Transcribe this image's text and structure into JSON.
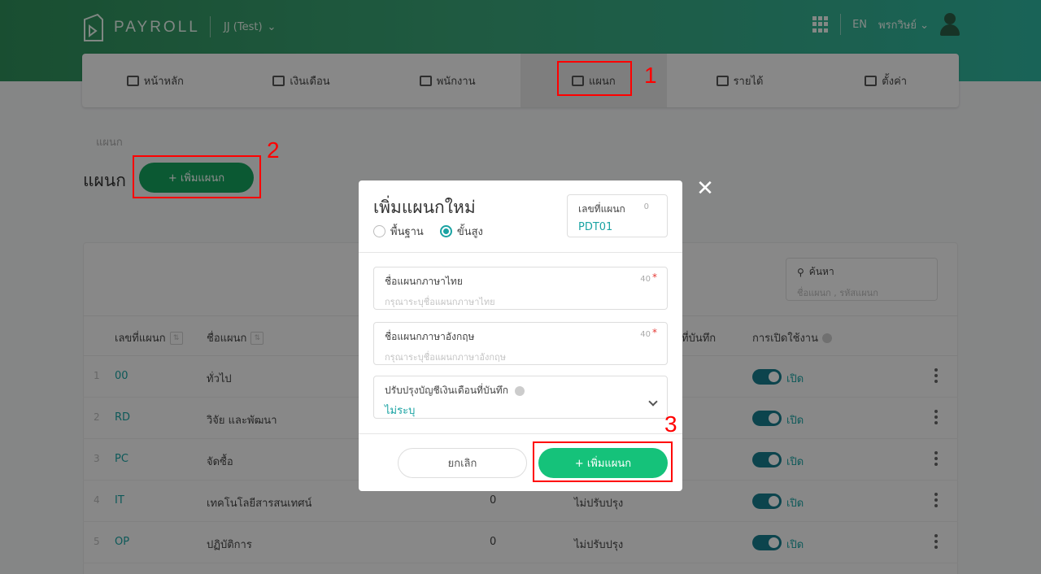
{
  "header": {
    "logo_text": "PAYROLL",
    "company": "JJ (Test)",
    "language": "EN",
    "user_name": "พรกวิษย์"
  },
  "nav": [
    {
      "label": "หน้าหลัก",
      "icon": "chart-icon"
    },
    {
      "label": "เงินเดือน",
      "icon": "calendar-money-icon"
    },
    {
      "label": "พนักงาน",
      "icon": "people-icon"
    },
    {
      "label": "แผนก",
      "icon": "id-card-icon",
      "active": true
    },
    {
      "label": "รายได้",
      "icon": "money-icon"
    },
    {
      "label": "ตั้งค่า",
      "icon": "gears-icon"
    }
  ],
  "page": {
    "breadcrumb": "แผนก",
    "title": "แผนก",
    "add_button": "+ เพิ่มแผนก"
  },
  "search": {
    "label": "ค้นหา",
    "placeholder": "ชื่อแผนก , รหัสแผนก"
  },
  "table": {
    "columns": [
      "เลขที่แผนก",
      "ชื่อแผนก",
      "ที่บันทึก",
      "การเปิดใช้งาน"
    ],
    "rows": [
      {
        "index": "1",
        "code": "00",
        "name": "ทั่วไป",
        "count": "",
        "adjust": "",
        "status": "เปิด"
      },
      {
        "index": "2",
        "code": "RD",
        "name": "วิจัย และพัฒนา",
        "count": "",
        "adjust": "",
        "status": "เปิด"
      },
      {
        "index": "3",
        "code": "PC",
        "name": "จัดซื้อ",
        "count": "",
        "adjust": "",
        "status": "เปิด"
      },
      {
        "index": "4",
        "code": "IT",
        "name": "เทคโนโลยีสารสนเทศน์",
        "count": "0",
        "adjust": "ไม่ปรับปรุง",
        "status": "เปิด"
      },
      {
        "index": "5",
        "code": "OP",
        "name": "ปฏิบัติการ",
        "count": "0",
        "adjust": "ไม่ปรับปรุง",
        "status": "เปิด"
      }
    ]
  },
  "modal": {
    "title": "เพิ่มแผนกใหม่",
    "radio_basic": "พื้นฐาน",
    "radio_advanced": "ขั้นสูง",
    "selected_mode": "advanced",
    "code_label": "เลขที่แผนก",
    "code_count": "0",
    "code_value": "PDT01",
    "thai_name_label": "ชื่อแผนกภาษาไทย",
    "thai_name_placeholder": "กรุณาระบุชื่อแผนกภาษาไทย",
    "thai_name_max": "40",
    "eng_name_label": "ชื่อแผนกภาษาอังกฤษ",
    "eng_name_placeholder": "กรุณาระบุชื่อแผนกภาษาอังกฤษ",
    "eng_name_max": "40",
    "required_mark": "*",
    "adjust_label": "ปรับปรุงบัญชีเงินเดือนที่บันทึก",
    "adjust_value": "ไม่ระบุ",
    "cancel_button": "ยกเลิก",
    "add_button": "+ เพิ่มแผนก",
    "close_symbol": "✕"
  },
  "annotations": [
    "1",
    "2",
    "3"
  ],
  "colors": {
    "accent": "#1aa3a3",
    "primary_button": "#15a35d",
    "annotation": "#ff0000"
  }
}
